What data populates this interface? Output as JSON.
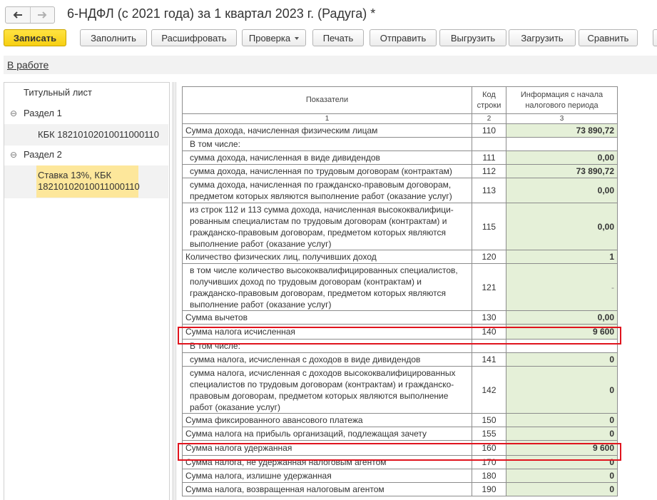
{
  "window": {
    "title": "6-НДФЛ (с 2021 года) за 1 квартал 2023 г. (Радуга) *"
  },
  "toolbar": {
    "save": "Записать",
    "fill": "Заполнить",
    "decode": "Расшифровать",
    "check": "Проверка",
    "print": "Печать",
    "send": "Отправить",
    "export": "Выгрузить",
    "import": "Загрузить",
    "compare": "Сравнить"
  },
  "status": {
    "link": "В работе"
  },
  "tree": {
    "title_sheet": "Титульный лист",
    "section1": "Раздел 1",
    "kbk": "КБК 18210102010011000110",
    "section2": "Раздел 2",
    "rate_line1": "Ставка 13%, КБК",
    "rate_line2": "18210102010011000110"
  },
  "table": {
    "headers": {
      "indicators": "Показатели",
      "code_line1": "Код",
      "code_line2": "строки",
      "info_line1": "Информация с начала",
      "info_line2": "налогового периода"
    },
    "colnums": [
      "1",
      "2",
      "3"
    ],
    "rows": [
      {
        "label": "Сумма дохода, начисленная физическим лицам",
        "code": "110",
        "value": "73 890,72"
      },
      {
        "label": "В том числе:"
      },
      {
        "label": "сумма дохода, начисленная в виде дивидендов",
        "code": "111",
        "value": "0,00"
      },
      {
        "label": "сумма дохода, начисленная по трудовым договорам (контрактам)",
        "code": "112",
        "value": "73 890,72"
      },
      {
        "label": "сумма дохода, начисленная по гражданско-правовым договорам, предметом которых являются выполнение работ (оказание услуг)",
        "code": "113",
        "value": "0,00"
      },
      {
        "label": "из строк 112 и 113 сумма дохода, начисленная высококвалифици-рованным специалистам по трудовым договорам (контрактам) и гражданско-правовым договорам, предметом которых являются выполнение работ (оказание услуг)",
        "code": "115",
        "value": "0,00"
      },
      {
        "label": "Количество физических лиц, получивших доход",
        "code": "120",
        "value": "1"
      },
      {
        "label": "в том числе количество высококвалифицированных специалистов, получивших доход по трудовым договорам (контрактам) и гражданско-правовым договорам, предметом которых являются выполнение работ (оказание услуг)",
        "code": "121",
        "value": "-"
      },
      {
        "label": "Сумма вычетов",
        "code": "130",
        "value": "0,00"
      },
      {
        "label": "Сумма налога исчисленная",
        "code": "140",
        "value": "9 600"
      },
      {
        "label": "В том числе:"
      },
      {
        "label": "сумма налога, исчисленная с доходов в виде дивидендов",
        "code": "141",
        "value": "0"
      },
      {
        "label": "сумма налога, исчисленная с доходов высококвалифицированных специалистов по трудовым договорам (контрактам) и гражданско-правовым договорам, предметом которых являются выполнение работ (оказание услуг)",
        "code": "142",
        "value": "0"
      },
      {
        "label": "Сумма фиксированного авансового платежа",
        "code": "150",
        "value": "0"
      },
      {
        "label": "Сумма налога на прибыль организаций, подлежащая зачету",
        "code": "155",
        "value": "0"
      },
      {
        "label": "Сумма налога удержанная",
        "code": "160",
        "value": "9 600"
      },
      {
        "label": "Сумма налога, не удержанная налоговым агентом",
        "code": "170",
        "value": "0"
      },
      {
        "label": "Сумма налога, излишне удержанная",
        "code": "180",
        "value": "0"
      },
      {
        "label": "Сумма налога, возвращенная налоговым агентом",
        "code": "190",
        "value": "0"
      }
    ]
  }
}
